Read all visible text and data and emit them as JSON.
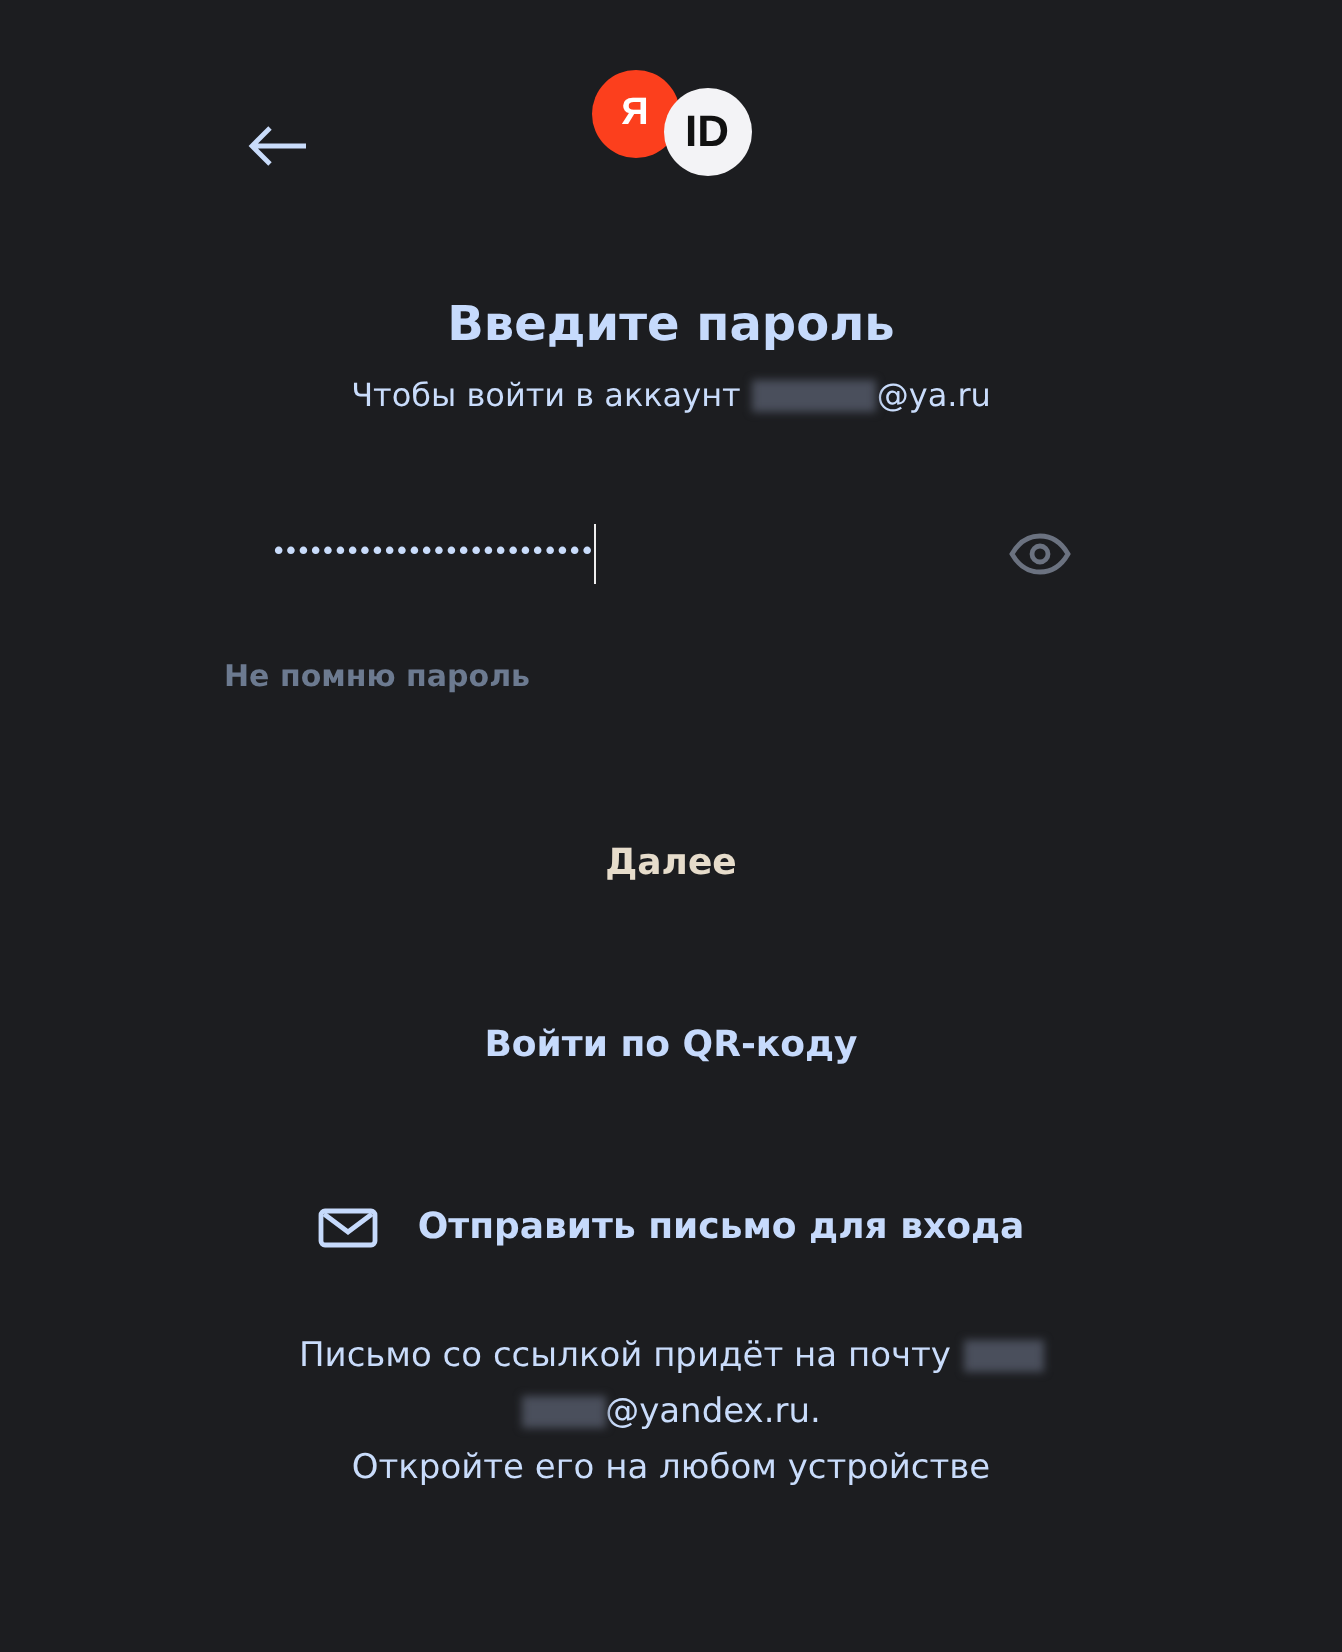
{
  "logo": {
    "letter": "Я",
    "text": "ID"
  },
  "title": "Введите пароль",
  "subtitle": {
    "prefix": "Чтобы войти в аккаунт",
    "suffix": "@ya.ru"
  },
  "password_field": {
    "masked_value": "••••••••••••••••••••••••••"
  },
  "forgot_link": "Не помню пароль",
  "next_button": "Далее",
  "qr_button": "Войти по QR-коду",
  "email_button": "Отправить письмо для входа",
  "info": {
    "line_1": "Письмо со ссылкой придёт на почту",
    "line_2": "@yandex.ru.",
    "line_3": "Откройте его на любом устройстве"
  }
}
